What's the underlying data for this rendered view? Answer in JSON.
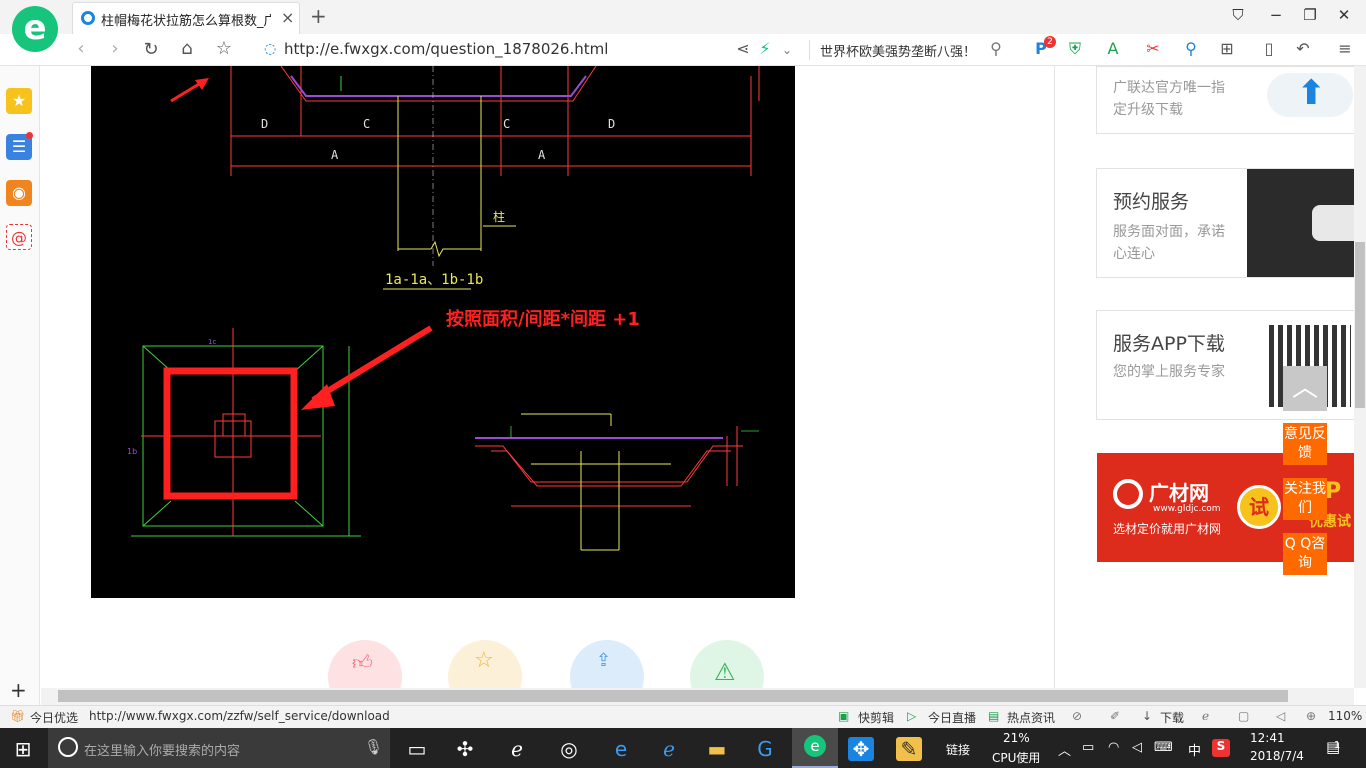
{
  "browser": {
    "logo": "e",
    "tab_title": "柱帽梅花状拉筋怎么算根数_广联",
    "tab_close": "×",
    "new_tab": "+",
    "url": "http://e.fwxgx.com/question_1878026.html",
    "news_query": "世界杯欧美强势垄断八强！",
    "ad_badge": "2"
  },
  "cad": {
    "dim_D1": "D",
    "dim_C1": "C",
    "dim_C2": "C",
    "dim_D2": "D",
    "dim_A1": "A",
    "dim_A2": "A",
    "column_label": "柱",
    "section_label": "1a-1a、1b-1b",
    "annotation": "按照面积/间距*间距 +1"
  },
  "sidebar_cards": [
    {
      "title": "",
      "sub": "广联达官方唯一指定升级下载"
    },
    {
      "title": "预约服务",
      "sub": "服务面对面，承诺心连心"
    },
    {
      "title": "服务APP下载",
      "sub": "您的掌上服务专家"
    }
  ],
  "ad_banner": {
    "brand": "广材网",
    "url_text": "www.gldjc.com",
    "slogan": "选材定价就用广材网",
    "try": "试",
    "vip": "P",
    "promo": "优惠试用"
  },
  "float_buttons": [
    "意见反馈",
    "关注我们",
    "Q Q咨询"
  ],
  "status": {
    "daily_pick": "今日优选",
    "link_url": "http://www.fwxgx.com/zzfw/self_service/download",
    "quick_clip": "快剪辑",
    "live": "今日直播",
    "hot_news": "热点资讯",
    "download": "下载",
    "zoom": "110%"
  },
  "taskbar": {
    "search_placeholder": "在这里输入你要搜索的内容",
    "link_label": "链接",
    "cpu_percent": "21%",
    "cpu_label": "CPU使用",
    "ime": "中",
    "time": "12:41",
    "date": "2018/7/4",
    "notif_count": "1"
  },
  "colors": {
    "brand_green": "#17c47b",
    "accent_blue": "#1a84e0",
    "annotation_red": "#ff2020",
    "float_orange": "#ff6a00",
    "ad_red": "#dd2b1c"
  }
}
